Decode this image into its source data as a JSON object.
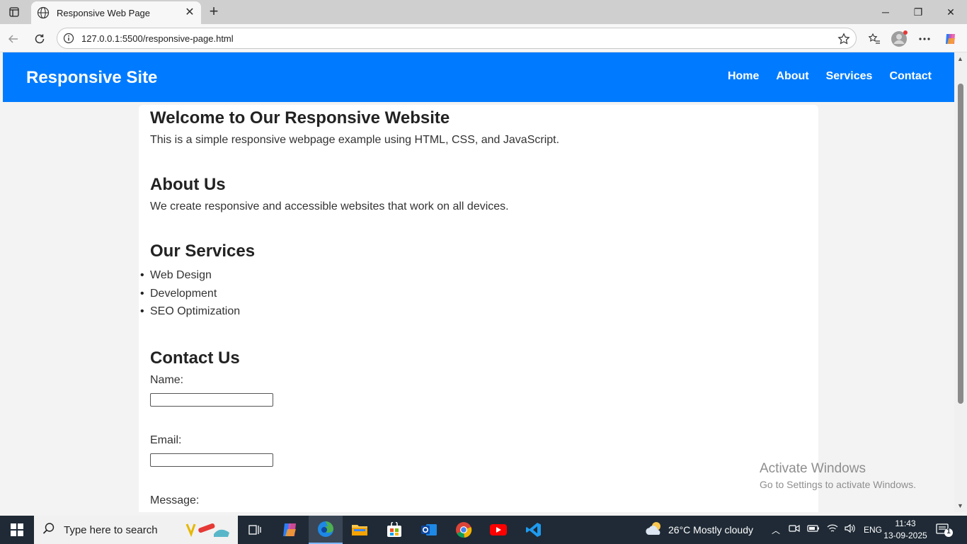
{
  "browser": {
    "tab_title": "Responsive Web Page",
    "url": "127.0.0.1:5500/responsive-page.html"
  },
  "site": {
    "logo": "Responsive Site",
    "nav": [
      "Home",
      "About",
      "Services",
      "Contact"
    ],
    "welcome": {
      "title": "Welcome to Our Responsive Website",
      "text": "This is a simple responsive webpage example using HTML, CSS, and JavaScript."
    },
    "about": {
      "title": "About Us",
      "text": "We create responsive and accessible websites that work on all devices."
    },
    "services": {
      "title": "Our Services",
      "items": [
        "Web Design",
        "Development",
        "SEO Optimization"
      ]
    },
    "contact": {
      "title": "Contact Us",
      "name_label": "Name:",
      "email_label": "Email:",
      "message_label": "Message:"
    }
  },
  "watermark": {
    "line1": "Activate Windows",
    "line2": "Go to Settings to activate Windows."
  },
  "taskbar": {
    "search_placeholder": "Type here to search",
    "weather": "26°C  Mostly cloudy",
    "lang": "ENG",
    "time": "11:43",
    "date": "13-09-2025",
    "notification_count": "1"
  },
  "colors": {
    "header_bg": "#007bff",
    "taskbar_bg": "#1f2a36"
  }
}
